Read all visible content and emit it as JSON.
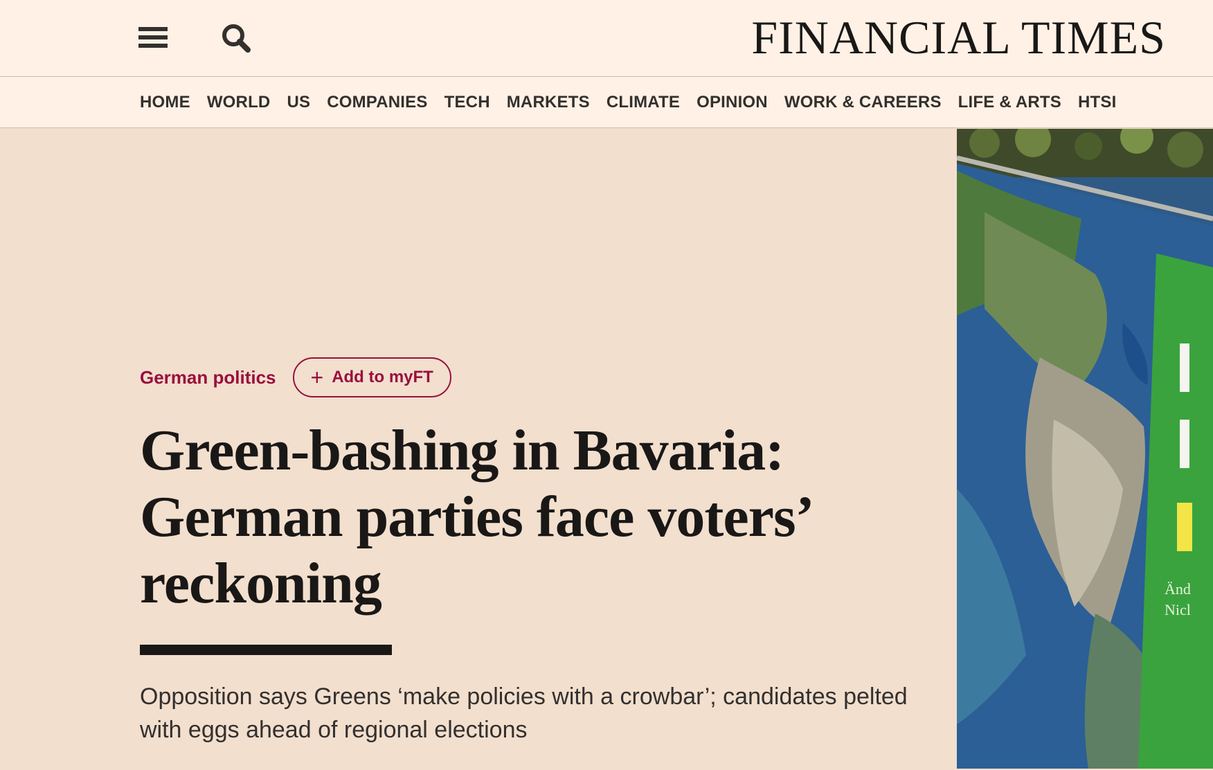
{
  "header": {
    "logo": "FINANCIAL TIMES",
    "menu_icon": "hamburger-menu-icon",
    "search_icon": "search-icon"
  },
  "nav": {
    "items": [
      {
        "label": "HOME"
      },
      {
        "label": "WORLD"
      },
      {
        "label": "US"
      },
      {
        "label": "COMPANIES"
      },
      {
        "label": "TECH"
      },
      {
        "label": "MARKETS"
      },
      {
        "label": "CLIMATE"
      },
      {
        "label": "OPINION"
      },
      {
        "label": "WORK & CAREERS"
      },
      {
        "label": "LIFE & ARTS"
      },
      {
        "label": "HTSI"
      }
    ]
  },
  "article": {
    "topic": "German politics",
    "myft_button": "Add to myFT",
    "headline": "Green-bashing in Bavaria: German parties face voters’ reckoning",
    "standfirst": "Opposition says Greens ‘make policies with a crowbar’; candidates pelted with eggs ahead of regional elections"
  },
  "photo": {
    "poster_text_line1": "Änd",
    "poster_text_line2": "Nicl"
  },
  "colors": {
    "page_background": "#f2dfce",
    "header_background": "#fff1e5",
    "accent": "#990f3d",
    "text": "#33302e",
    "headline": "#1a1817"
  }
}
